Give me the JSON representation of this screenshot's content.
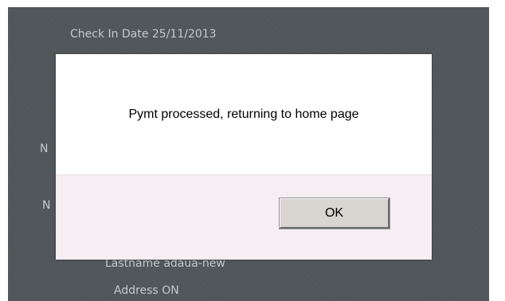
{
  "background": {
    "check_in_line": "Check In Date 25/11/2013",
    "partial_label_1": "N",
    "partial_label_2": "N",
    "lastname_line": "Lastname adaua-new",
    "address_line": "Address ON"
  },
  "dialog": {
    "message": "Pymt processed, returning to home page",
    "ok_label": "OK"
  }
}
